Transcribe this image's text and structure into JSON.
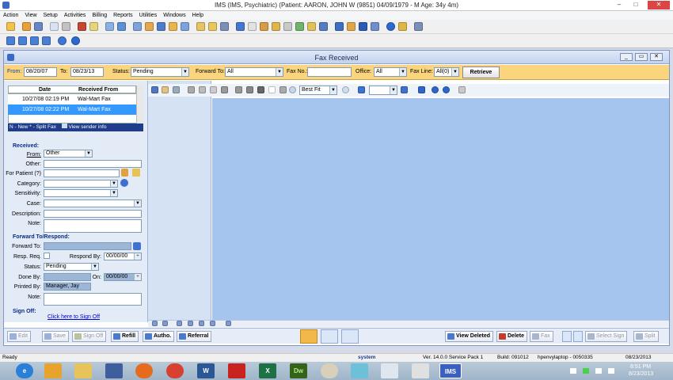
{
  "window": {
    "title": "IMS (IMS, Psychiatric)    (Patient: AARON, JOHN W (9851) 04/09/1979 - M Age: 34y 4m)"
  },
  "menu": [
    "Action",
    "View",
    "Setup",
    "Activities",
    "Billing",
    "Reports",
    "Utilities",
    "Windows",
    "Help"
  ],
  "child": {
    "title": "Fax Received"
  },
  "filter": {
    "from_label": "From:",
    "from_value": "08/20/07",
    "to_label": "To:",
    "to_value": "08/23/13",
    "status_label": "Status:",
    "status_value": "Pending",
    "forward_label": "Forward To:",
    "forward_value": "All",
    "faxno_label": "Fax No.:",
    "faxno_value": "",
    "office_label": "Office:",
    "office_value": "All",
    "faxline_label": "Fax Line:",
    "faxline_value": "All(0)",
    "retrieve_label": "Retrieve"
  },
  "fax_list": {
    "headers": {
      "date": "Date",
      "from": "Received From"
    },
    "rows": [
      {
        "date": "10/27/08  02:19 PM",
        "from": "Wal-Mart Fax"
      },
      {
        "date": "10/27/08  02:22 PM",
        "from": "Wal-Mart Fax"
      }
    ],
    "legend": "N - New  * - Split Fax",
    "view_sender": "View sender info"
  },
  "received": {
    "section": "Received:",
    "from_label": "From:",
    "from_value": "Other",
    "other_label": "Other:",
    "patient_label": "For Patient (?)",
    "category_label": "Category:",
    "sensitivity_label": "Sensitivity:",
    "case_label": "Case:",
    "description_label": "Description:",
    "note_label": "Note:"
  },
  "forward": {
    "section": "Forward To/Respond:",
    "forward_label": "Forward To:",
    "resp_req_label": "Resp. Req.",
    "respond_by_label": "Respond By:",
    "respond_by_value": "00/00/00",
    "status_label": "Status:",
    "status_value": "Pending",
    "done_by_label": "Done By:",
    "on_label": "On:",
    "on_value": "00/00/00",
    "printed_by_label": "Printed By:",
    "printed_by_value": "Manager, Jay",
    "note_label": "Note:"
  },
  "signoff": {
    "section": "Sign Off:",
    "link": "Click here to Sign Off"
  },
  "viewer": {
    "zoom": "Best Fit"
  },
  "actions": {
    "edit": "Edit",
    "save": "Save",
    "sign_off": "Sign Off",
    "refill": "Refill",
    "autho": "Autho.",
    "referral": "Referral",
    "view_deleted": "View Deleted",
    "delete": "Delete",
    "fax": "Fax",
    "select_sign": "Select Sign",
    "split": "Split"
  },
  "status": {
    "ready": "Ready",
    "user": "system",
    "version": "Ver. 14.0.0 Service Pack 1",
    "build": "Build: 091012",
    "machine": "hpenvylaptop - 0050335",
    "date": "08/23/2013"
  },
  "clock": {
    "time": "8:51 PM",
    "date": "8/23/2013"
  },
  "taskbar_ims": "IMS",
  "colors": {
    "filter_bg": "#fbd57e",
    "viewer_bg": "#a5c4ee",
    "selected_row": "#3399ff",
    "accent": "#1f3d8a"
  }
}
